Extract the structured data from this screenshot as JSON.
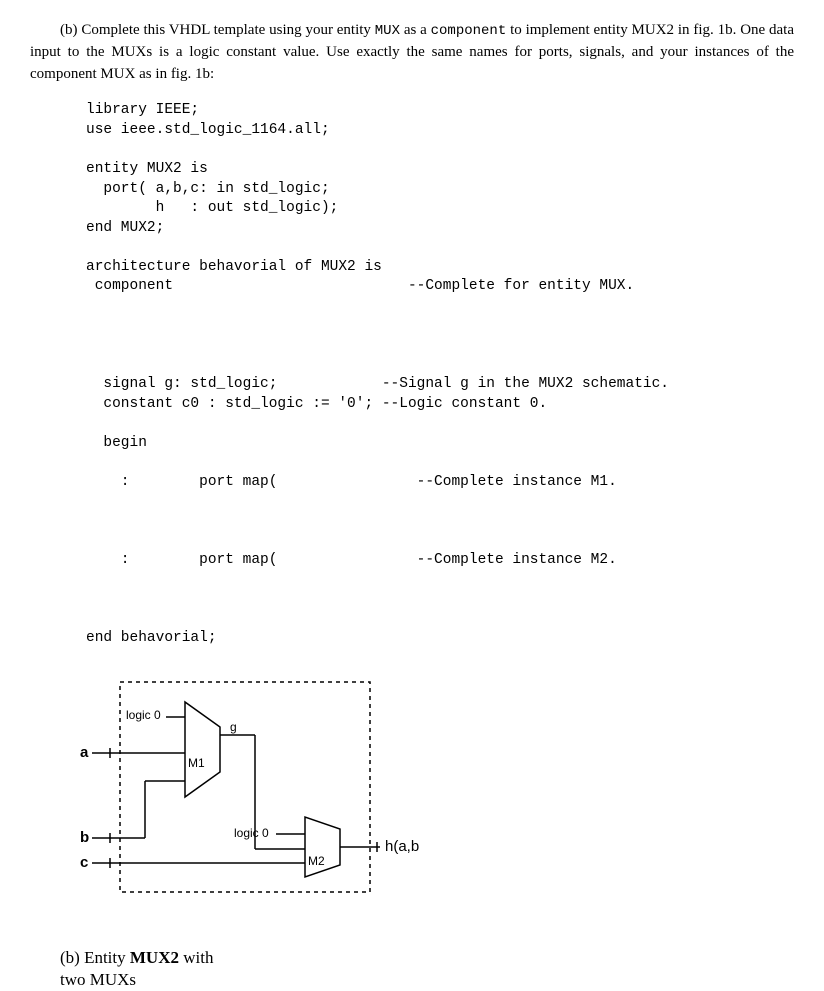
{
  "problem": {
    "part_label": "(b)",
    "text_1": "Complete this VHDL template using your entity ",
    "mux": "MUX",
    "text_2": " as a ",
    "component": "component",
    "text_3": " to implement entity MUX2 in fig. 1b. One data input to the MUXs is a logic constant value. Use exactly the same names for ports, signals, and your instances of the component MUX as in fig. 1b:"
  },
  "code": {
    "l01": "library IEEE;",
    "l02": "use ieee.std_logic_1164.all;",
    "l03": "",
    "l04": "entity MUX2 is",
    "l05": "  port( a,b,c: in std_logic;",
    "l06": "        h   : out std_logic);",
    "l07": "end MUX2;",
    "l08": "",
    "l09": "architecture behavorial of MUX2 is",
    "l10": " component                           --Complete for entity MUX.",
    "l11": "",
    "l12": "",
    "l13": "",
    "l14": "",
    "l15": "  signal g: std_logic;            --Signal g in the MUX2 schematic.",
    "l16": "  constant c0 : std_logic := '0'; --Logic constant 0.",
    "l17": "",
    "l18": "  begin",
    "l19": "",
    "l20": "    :        port map(                --Complete instance M1.",
    "l21": "",
    "l22": "",
    "l23": "",
    "l24": "    :        port map(                --Complete instance M2.",
    "l25": "",
    "l26": "",
    "l27": "",
    "l28": "end behavorial;"
  },
  "schematic": {
    "port_a": "a",
    "port_b": "b",
    "port_c": "c",
    "logic0_1": "logic 0",
    "logic0_2": "logic 0",
    "sig_g": "g",
    "inst_m1": "M1",
    "inst_m2": "M2",
    "output": "h(a,b,c)"
  },
  "caption": {
    "part": "(b)",
    "text1": "Entity ",
    "bold": "MUX2",
    "text2": " with",
    "text3": "two MUXs"
  }
}
